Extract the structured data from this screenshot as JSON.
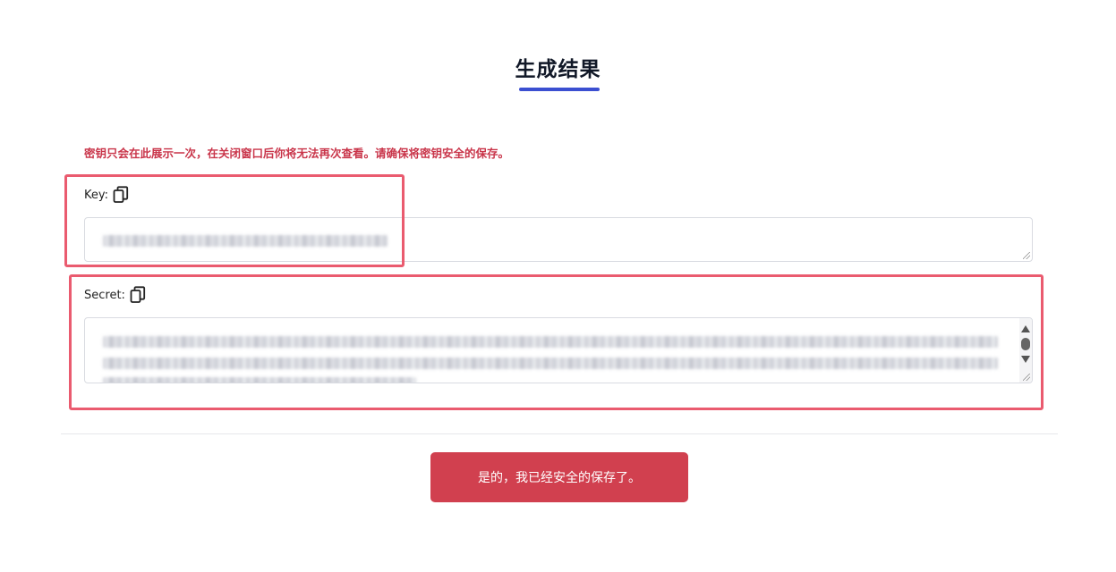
{
  "dialog": {
    "title": "生成结果",
    "warning": "密钥只会在此展示一次，在关闭窗口后你将无法再次查看。请确保将密钥安全的保存。",
    "key_field": {
      "label": "Key:"
    },
    "secret_field": {
      "label": "Secret:"
    },
    "confirm_button_label": "是的，我已经安全的保存了。"
  },
  "icons": {
    "copy": "copy-icon"
  },
  "colors": {
    "accent_underline": "#3b4fd1",
    "warning_text": "#c9354a",
    "confirm_button": "#d1404f",
    "highlight_box": "#ea5b6f"
  }
}
